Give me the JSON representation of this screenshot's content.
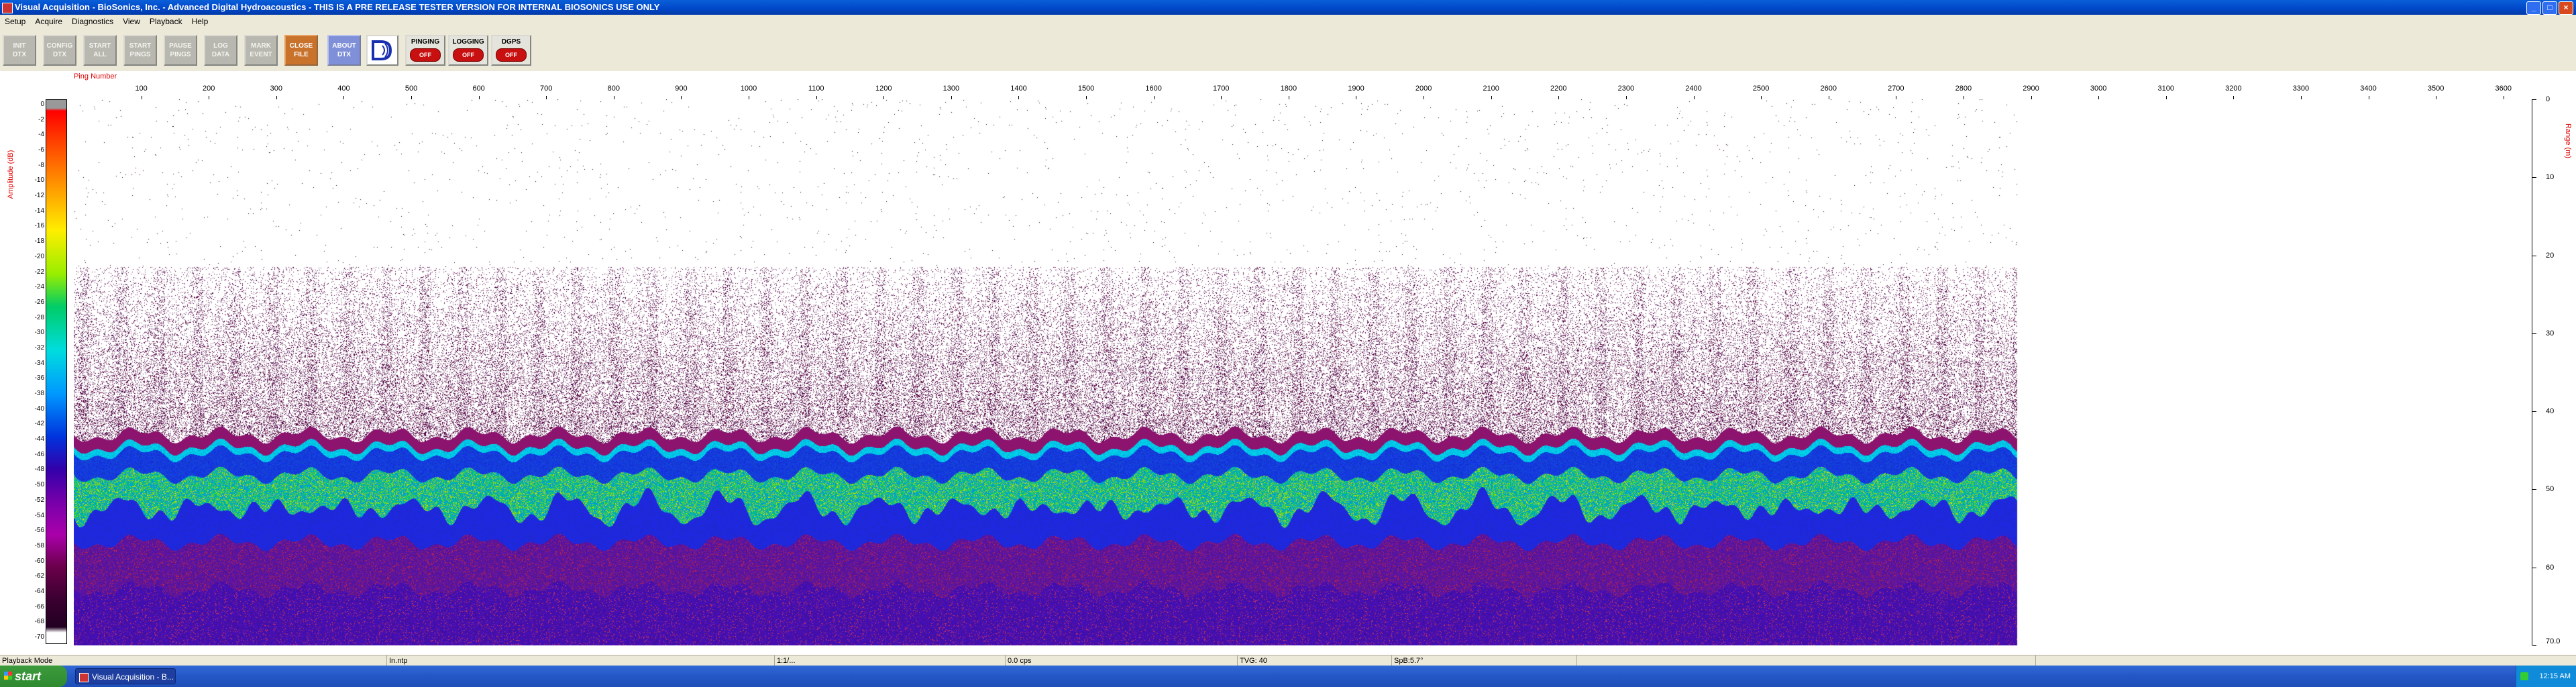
{
  "window": {
    "title": "Visual Acquisition  -  BioSonics, Inc.  -  Advanced Digital Hydroacoustics  -  THIS IS A PRE RELEASE TESTER VERSION FOR INTERNAL BIOSONICS USE ONLY",
    "minimize": "_",
    "maximize": "□",
    "close": "×"
  },
  "menu": [
    "Setup",
    "Acquire",
    "Diagnostics",
    "View",
    "Playback",
    "Help"
  ],
  "toolbar": {
    "buttons": [
      {
        "line1": "INIT",
        "line2": "DTX"
      },
      {
        "line1": "CONFIG",
        "line2": "DTX"
      },
      {
        "line1": "START",
        "line2": "ALL"
      },
      {
        "line1": "START",
        "line2": "PINGS"
      },
      {
        "line1": "PAUSE",
        "line2": "PINGS"
      },
      {
        "line1": "LOG",
        "line2": "DATA"
      },
      {
        "line1": "MARK",
        "line2": "EVENT"
      },
      {
        "line1": "CLOSE",
        "line2": "FILE"
      },
      {
        "line1": "ABOUT",
        "line2": "DTX"
      }
    ],
    "logo_text": "D",
    "indicators": [
      {
        "label": "PINGING",
        "state": "OFF"
      },
      {
        "label": "LOGGING",
        "state": "OFF"
      },
      {
        "label": "DGPS",
        "state": "OFF"
      }
    ]
  },
  "echogram": {
    "ping_axis_label": "Ping Number",
    "ping_ticks": [
      "100",
      "200",
      "300",
      "400",
      "500",
      "600",
      "700",
      "800",
      "900",
      "1000",
      "1100",
      "1200",
      "1300",
      "1400",
      "1500",
      "1600",
      "1700",
      "1800",
      "1900",
      "2000",
      "2100",
      "2200",
      "2300",
      "2400",
      "2500",
      "2600",
      "2700",
      "2800",
      "2900",
      "3000",
      "3100",
      "3200",
      "3300",
      "3400",
      "3500",
      "3600"
    ],
    "amplitude_label": "Amplitude (dB)",
    "amplitude_ticks": [
      "0",
      "-2",
      "-4",
      "-6",
      "-8",
      "-10",
      "-12",
      "-14",
      "-16",
      "-18",
      "-20",
      "-22",
      "-24",
      "-26",
      "-28",
      "-30",
      "-32",
      "-34",
      "-36",
      "-38",
      "-40",
      "-42",
      "-44",
      "-46",
      "-48",
      "-50",
      "-52",
      "-54",
      "-56",
      "-58",
      "-60",
      "-62",
      "-64",
      "-66",
      "-68",
      "-70"
    ],
    "range_label": "Range (m)",
    "range_ticks": [
      "0",
      "10",
      "20",
      "30",
      "40",
      "50",
      "60",
      "70.0"
    ],
    "pings_recorded": 2880,
    "max_ping": 3640,
    "max_range_m": 70.0
  },
  "statusbar": [
    "Playback Mode",
    "In.ntp",
    "1:1/...",
    "0.0 cps",
    "TVG: 40",
    "SpB:5.7°",
    "",
    ""
  ],
  "taskbar": {
    "start_label": "start",
    "task_label": "Visual Acquisition  -  B...",
    "clock": "12:15 AM"
  }
}
